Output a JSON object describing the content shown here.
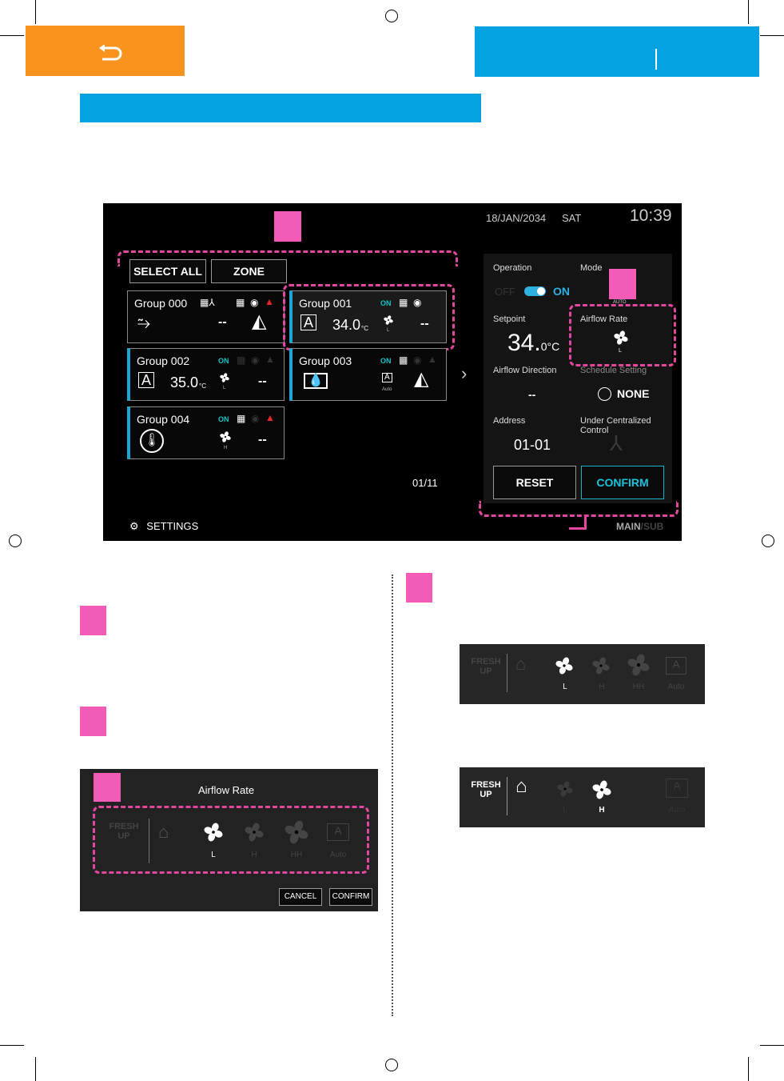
{
  "header": {
    "back_icon": "return-arrow-icon",
    "orange": "#f7931e",
    "blue": "#05a2e2"
  },
  "screen": {
    "select_all": "SELECT ALL",
    "zone": "ZONE",
    "groups": [
      {
        "name": "Group 000",
        "on": "",
        "setpoint": "",
        "airflow": "",
        "direction": "--",
        "mode_icon": "dry-mode-icon"
      },
      {
        "name": "Group 001",
        "on": "ON",
        "setpoint": "34.0",
        "unit": "°C",
        "airflow": "L",
        "direction": "--"
      },
      {
        "name": "Group 002",
        "on": "ON",
        "setpoint": "35.0",
        "unit": "°C",
        "airflow": "L",
        "direction": "--"
      },
      {
        "name": "Group 003",
        "on": "ON",
        "setpoint": "",
        "airflow": "Auto",
        "direction": ""
      },
      {
        "name": "Group 004",
        "on": "ON",
        "setpoint": "",
        "airflow": "H",
        "direction": "--"
      }
    ],
    "page": "01/11",
    "settings": "SETTINGS",
    "date": "18/JAN/2034",
    "day": "SAT",
    "time": "10:39",
    "detail": {
      "operation_label": "Operation",
      "off": "OFF",
      "on": "ON",
      "mode_label": "Mode",
      "mode_value": "AUTO",
      "setpoint_label": "Setpoint",
      "setpoint": "34.",
      "setpoint_dec": "0°C",
      "airflow_label": "Airflow Rate",
      "airflow_value": "L",
      "direction_label": "Airflow Direction",
      "direction_value": "--",
      "schedule_label": "Schedule Setting",
      "schedule_value": "NONE",
      "address_label": "Address",
      "address_value": "01-01",
      "central_label": "Under Centralized Control",
      "reset": "RESET",
      "confirm": "CONFIRM"
    },
    "main": "MAIN",
    "sub": "/SUB"
  },
  "airflow_dialog": {
    "title": "Airflow Rate",
    "fresh_up": "FRESH UP",
    "levels": [
      "L",
      "H",
      "HH",
      "Auto"
    ],
    "selected": "L",
    "cancel": "CANCEL",
    "confirm": "CONFIRM"
  },
  "bar1": {
    "fresh_up": "FRESH UP",
    "levels": [
      "L",
      "H",
      "HH",
      "Auto"
    ],
    "selected": "L"
  },
  "bar2": {
    "fresh_up": "FRESH UP",
    "levels": [
      "L",
      "H",
      "Auto"
    ],
    "selected": "H"
  }
}
